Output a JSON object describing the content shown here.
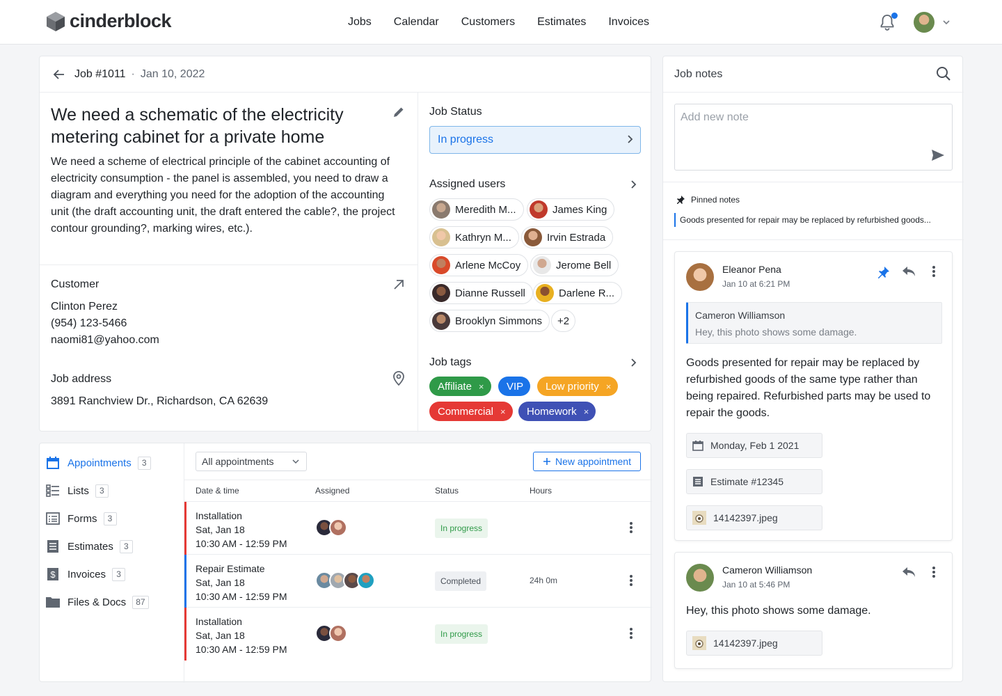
{
  "app": {
    "brand": "cinderblock"
  },
  "nav": [
    "Jobs",
    "Calendar",
    "Customers",
    "Estimates",
    "Invoices"
  ],
  "job": {
    "number": "Job #1011",
    "date": "Jan 10, 2022",
    "title": "We need a schematic of the electricity metering cabinet for a private home",
    "description": "We need a scheme of electrical principle of the cabinet accounting of electricity consumption - the panel is assembled, you need to draw a diagram and everything you need for the adoption of the accounting unit (the draft accounting unit, the draft entered the cable?, the project contour grounding?, marking wires, etc.).",
    "customer_label": "Customer",
    "customer_name": "Clinton Perez",
    "customer_phone": "(954) 123-5466",
    "customer_email": "naomi81@yahoo.com",
    "address_label": "Job address",
    "address": "3891 Ranchview Dr., Richardson, CA 62639",
    "status_label": "Job Status",
    "status": "In progress",
    "assigned_label": "Assigned users",
    "assigned_users": [
      "Meredith M...",
      "James King",
      "Kathryn M...",
      "Irvin Estrada",
      "Arlene McCoy",
      "Jerome Bell",
      "Dianne Russell",
      "Darlene R...",
      "Brooklyn Simmons"
    ],
    "assigned_more": "+2",
    "tags_label": "Job tags",
    "tags": [
      {
        "label": "Affiliate",
        "color": "#2f9a48"
      },
      {
        "label": "VIP",
        "color": "#1a73e8"
      },
      {
        "label": "Low priority",
        "color": "#f5a524"
      },
      {
        "label": "Commercial",
        "color": "#e53935"
      },
      {
        "label": "Homework",
        "color": "#3f51b5"
      }
    ],
    "tag_remove": "×"
  },
  "sidebar": [
    {
      "label": "Appointments",
      "count": "3"
    },
    {
      "label": "Lists",
      "count": "3"
    },
    {
      "label": "Forms",
      "count": "3"
    },
    {
      "label": "Estimates",
      "count": "3"
    },
    {
      "label": "Invoices",
      "count": "3"
    },
    {
      "label": "Files & Docs",
      "count": "87"
    }
  ],
  "appointments": {
    "filter": "All appointments",
    "new_button": "New appointment",
    "columns": [
      "Date & time",
      "Assigned",
      "Status",
      "Hours"
    ],
    "rows": [
      {
        "title": "Installation",
        "date": "Sat, Jan 18",
        "time": "10:30 AM - 12:59 PM",
        "status": "In progress",
        "hours": "",
        "accent": "#e53935"
      },
      {
        "title": "Repair Estimate",
        "date": "Sat, Jan 18",
        "time": "10:30 AM - 12:59 PM",
        "status": "Completed",
        "hours": "24h 0m",
        "accent": "#1a73e8"
      },
      {
        "title": "Installation",
        "date": "Sat, Jan 18",
        "time": "10:30 AM - 12:59 PM",
        "status": "In progress",
        "hours": "",
        "accent": "#e53935"
      }
    ]
  },
  "notes": {
    "title": "Job notes",
    "placeholder": "Add new note",
    "pinned_label": "Pinned notes",
    "pinned_text": "Goods presented for repair may be replaced by refurbished goods...",
    "items": [
      {
        "author": "Eleanor Pena",
        "time": "Jan 10 at 6:21 PM",
        "quote_author": "Cameron Williamson",
        "quote_text": "Hey, this photo shows some damage.",
        "body": "Goods presented for repair may be replaced by refurbished goods of the same type rather than being repaired. Refurbished parts may be used to repair the goods.",
        "attachments": [
          "Monday, Feb 1 2021",
          "Estimate #12345",
          "14142397.jpeg"
        ]
      },
      {
        "author": "Cameron Williamson",
        "time": "Jan 10 at 5:46 PM",
        "body": "Hey, this photo shows some damage.",
        "attachments": [
          "14142397.jpeg"
        ]
      }
    ]
  }
}
